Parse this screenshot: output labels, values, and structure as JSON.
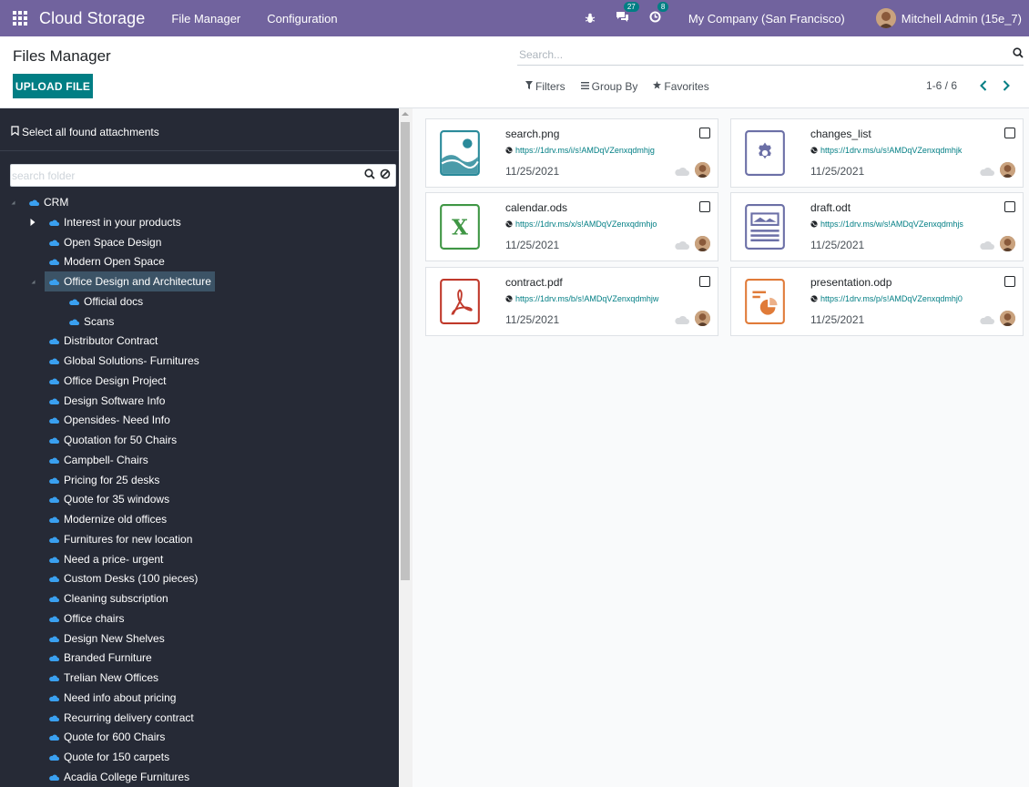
{
  "navbar": {
    "app_name": "Cloud Storage",
    "menus": [
      "File Manager",
      "Configuration"
    ],
    "messages_count": "27",
    "activities_count": "8",
    "company": "My Company (San Francisco)",
    "user": "Mitchell Admin (15e_7)",
    "color": "#71639e"
  },
  "control_panel": {
    "title": "Files Manager",
    "upload_label": "UPLOAD FILE",
    "search_placeholder": "Search...",
    "filters_label": "Filters",
    "groupby_label": "Group By",
    "favorites_label": "Favorites",
    "pager": "1-6 / 6"
  },
  "left_panel": {
    "select_all_label": "Select all found attachments",
    "folder_search_placeholder": "search folder",
    "root": "CRM",
    "folders": [
      "Interest in your products",
      "Open Space Design",
      "Modern Open Space",
      "Office Design and Architecture",
      "Official docs",
      "Scans",
      "Distributor Contract",
      "Global Solutions- Furnitures",
      "Office Design Project",
      "Design Software Info",
      "Opensides- Need Info",
      "Quotation for 50 Chairs",
      "Campbell- Chairs",
      "Pricing for 25 desks",
      "Quote for 35 windows",
      "Modernize old offices",
      "Furnitures for new location",
      "Need a price- urgent",
      "Custom Desks (100 pieces)",
      "Cleaning subscription",
      "Office chairs",
      "Design New Shelves",
      "Branded Furniture",
      "Trelian New Offices",
      "Need info about pricing",
      "Recurring delivery contract",
      "Quote for 600 Chairs",
      "Quote for 150 carpets",
      "Acadia College Furnitures"
    ],
    "selected_folder": "Office Design and Architecture"
  },
  "files": [
    {
      "name": "search.png",
      "url": "https://1drv.ms/i/s!AMDqVZenxqdmhjg",
      "date": "11/25/2021",
      "icon": "image-file-icon",
      "color": "#2a8a9a"
    },
    {
      "name": "changes_list",
      "url": "https://1drv.ms/u/s!AMDqVZenxqdmhjk",
      "date": "11/25/2021",
      "icon": "binary-file-icon",
      "color": "#6b6fa6"
    },
    {
      "name": "calendar.ods",
      "url": "https://1drv.ms/x/s!AMDqVZenxqdmhjo",
      "date": "11/25/2021",
      "icon": "spreadsheet-file-icon",
      "color": "#3f9644"
    },
    {
      "name": "draft.odt",
      "url": "https://1drv.ms/w/s!AMDqVZenxqdmhjs",
      "date": "11/25/2021",
      "icon": "document-file-icon",
      "color": "#6b6fa6"
    },
    {
      "name": "contract.pdf",
      "url": "https://1drv.ms/b/s!AMDqVZenxqdmhjw",
      "date": "11/25/2021",
      "icon": "pdf-file-icon",
      "color": "#c0392b"
    },
    {
      "name": "presentation.odp",
      "url": "https://1drv.ms/p/s!AMDqVZenxqdmhj0",
      "date": "11/25/2021",
      "icon": "presentation-file-icon",
      "color": "#e07b39"
    }
  ]
}
